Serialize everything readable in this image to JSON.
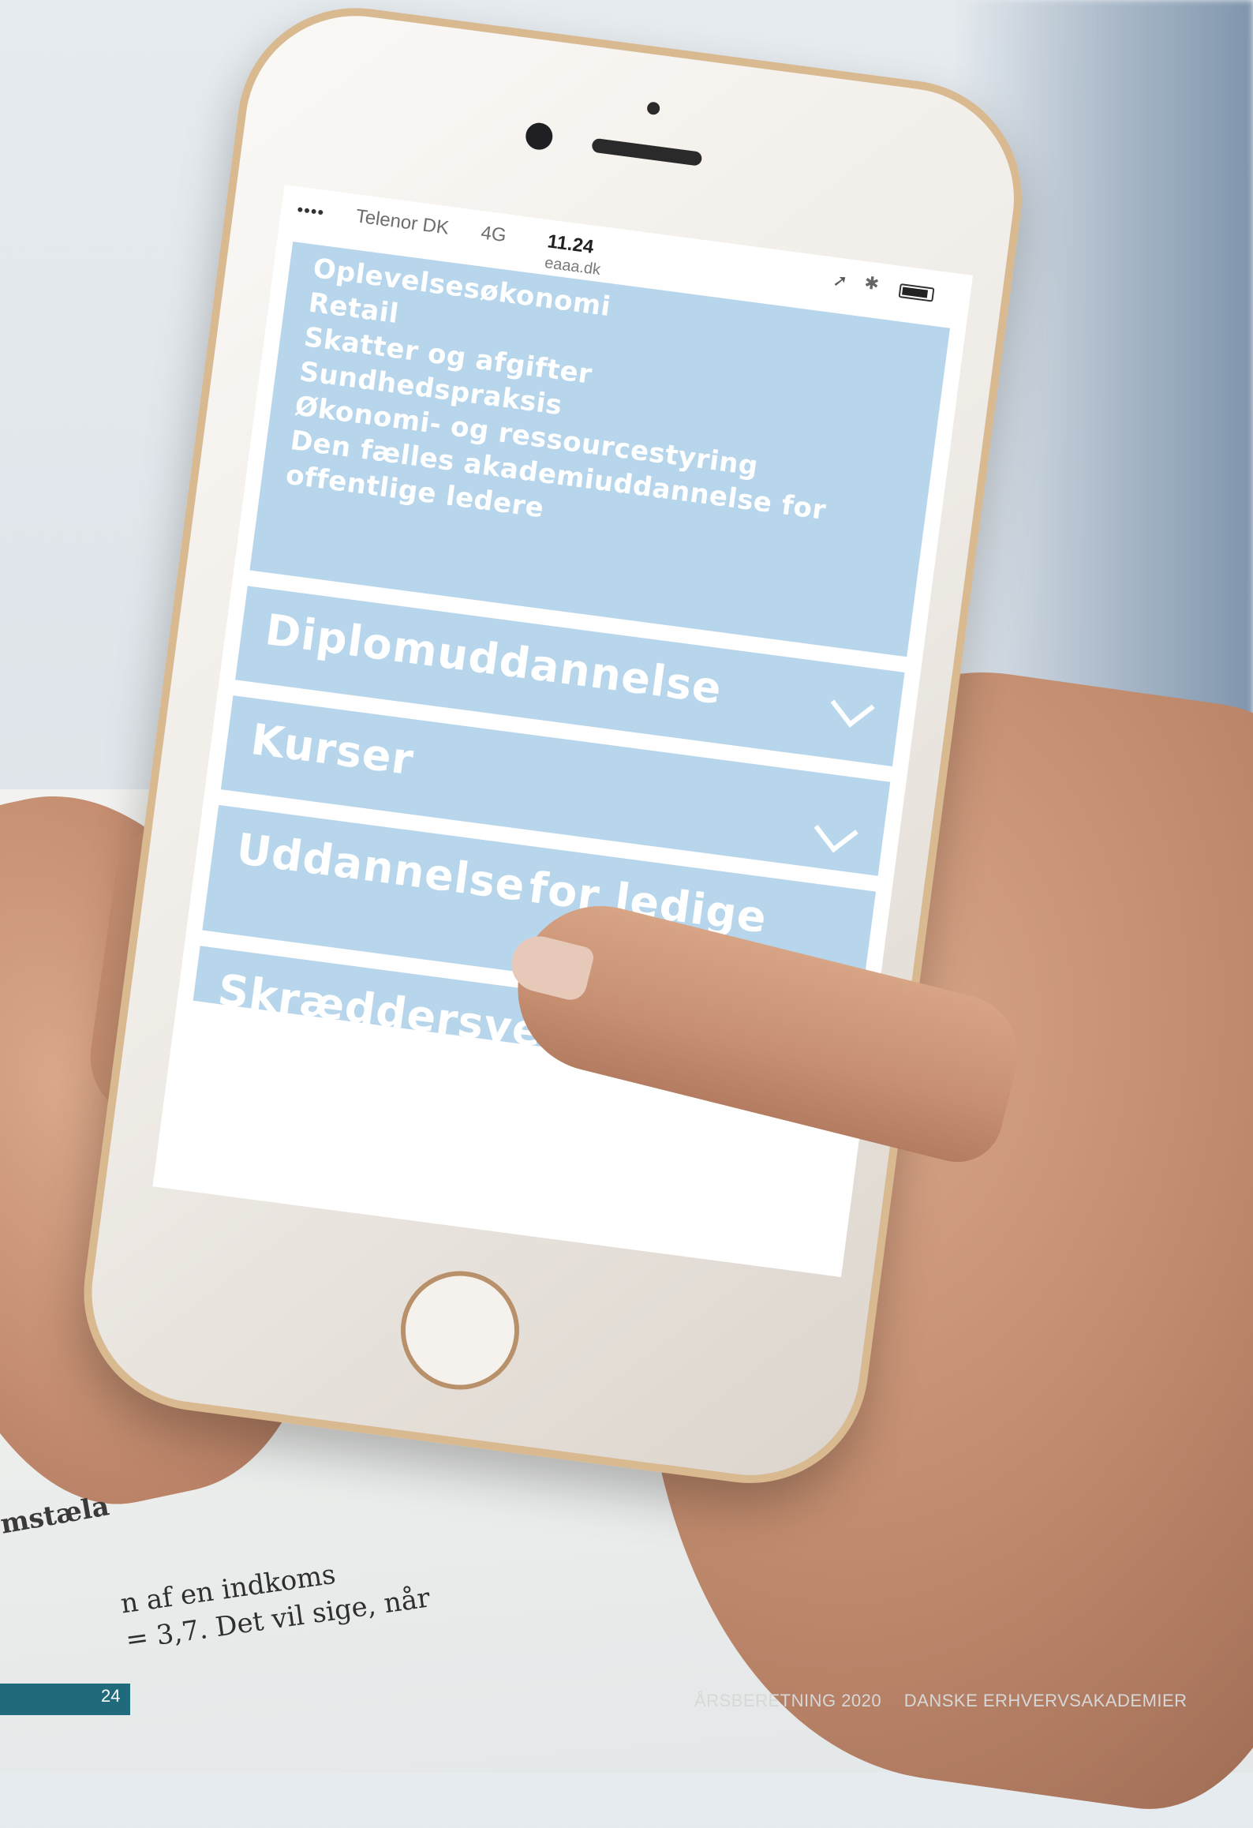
{
  "status_bar": {
    "signal": "••••",
    "carrier": "Telenor DK",
    "network": "4G",
    "time": "11.24",
    "url": "eaaa.dk"
  },
  "menu": {
    "links": [
      "Oplevelsesøkonomi",
      "Retail",
      "Skatter og afgifter",
      "Sundhedspraksis",
      "Økonomi- og ressourcestyring",
      "Den fælles akademiuddannelse for",
      "offentlige ledere"
    ],
    "sections": [
      {
        "label": "Diplomuddannelse"
      },
      {
        "label": "Kurser"
      },
      {
        "label": "Uddannelse"
      },
      {
        "label": "for ledige"
      },
      {
        "label": "Skræddersyede forløb"
      }
    ]
  },
  "paper": {
    "line1": "n af en indkoms",
    "line2": "= 3,7. Det vil sige, når",
    "left_word": "mstæla"
  },
  "footer": {
    "page_number": "24",
    "report": "ÅRSBERETNING 2020",
    "org": "DANSKE ERHVERVSAKADEMIER"
  },
  "icons": {
    "location": "location-arrow-icon",
    "bluetooth": "bluetooth-icon",
    "battery": "battery-icon",
    "chevron": "chevron-down-icon"
  },
  "colors": {
    "menu_blue": "#b7d6ec",
    "footer_teal": "#1f6b7c"
  }
}
